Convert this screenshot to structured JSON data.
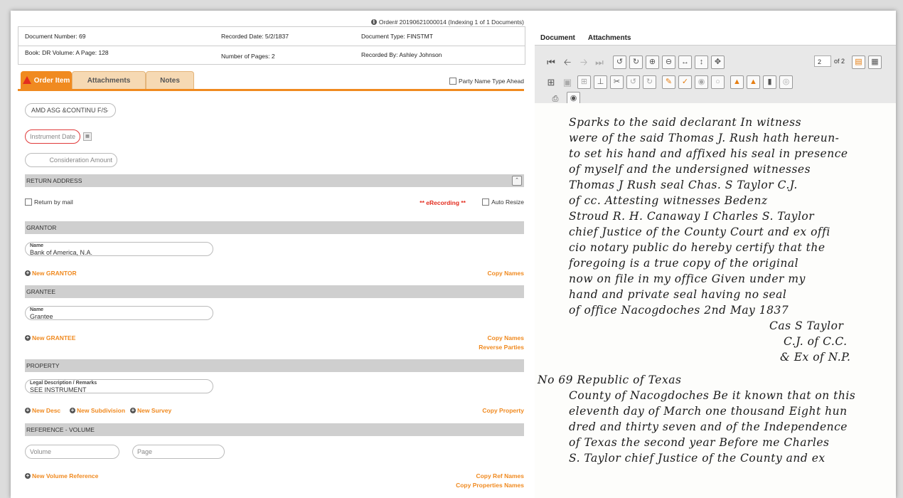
{
  "order": {
    "text": "Order# 20190621000014 (Indexing 1 of 1 Documents)"
  },
  "info": {
    "doc_number": "Document Number: 69",
    "recorded_date": "Recorded Date: 5/2/1837",
    "doc_type": "Document Type: FINSTMT",
    "book_volume_page": "Book: DR   Volume: A   Page: 128",
    "num_pages": "Number of Pages: 2",
    "recorded_by": "Recorded By: Ashley Johnson"
  },
  "tabs": [
    "Order Item",
    "Attachments",
    "Notes"
  ],
  "party_type_ahead": "Party Name Type Ahead",
  "form": {
    "instrument_type": "AMD ASG &CONTINU F/S",
    "instrument_date_placeholder": "Instrument Date",
    "consideration_placeholder": "Consideration Amount",
    "return_address": "RETURN ADDRESS",
    "return_by_mail": "Return by mail",
    "erecording": "** eRecording **",
    "auto_resize": "Auto Resize",
    "grantor_header": "GRANTOR",
    "grantor_name_label": "Name",
    "grantor_name": "Bank of America, N.A.",
    "new_grantor": "New GRANTOR",
    "copy_names_1": "Copy Names",
    "grantee_header": "GRANTEE",
    "grantee_name_label": "Name",
    "grantee_name": "Grantee",
    "new_grantee": "New GRANTEE",
    "copy_names_2": "Copy Names",
    "reverse_parties": "Reverse Parties",
    "property_header": "PROPERTY",
    "legal_desc_label": "Legal Description / Remarks",
    "legal_desc": "SEE INSTRUMENT",
    "new_desc": "New Desc",
    "new_subdivision": "New Subdivision",
    "new_survey": "New Survey",
    "copy_property": "Copy Property",
    "reference_header": "REFERENCE - VOLUME",
    "volume_placeholder": "Volume",
    "page_placeholder": "Page",
    "new_volume_ref": "New Volume Reference",
    "copy_ref_names": "Copy Ref Names",
    "copy_props_names": "Copy Properties Names"
  },
  "viewer": {
    "tabs": [
      "Document",
      "Attachments"
    ],
    "page_current": "2",
    "page_total": "of 2",
    "handwriting": [
      "Sparks to the said declarant  In witness",
      "were of the said Thomas J. Rush hath hereun-",
      "to set his hand and affixed his seal in presence",
      "of myself and the undersigned witnesses",
      "Thomas J Rush seal  Chas. S Taylor C.J.",
      "of cc. Attesting witnesses  Bedenz",
      "Stroud  R. H. Canaway  I Charles S. Taylor",
      "chief Justice of the County Court and ex offi",
      "cio notary public do hereby certify that the",
      "foregoing is a true copy of the original",
      "now on file in my office  Given under my",
      "hand and private seal having no seal",
      "of office  Nacogdoches 2nd May   1837",
      "Cas S Taylor",
      "C.J. of C.C.",
      "& Ex of N.P.",
      "No 69  Republic of Texas",
      "County of Nacogdoches  Be it known that on this",
      "eleventh day of March one thousand Eight hun",
      "dred and thirty seven and of the Independence",
      "of Texas the second year Before me  Charles",
      "S. Taylor chief Justice of the County and ex"
    ]
  },
  "colors": {
    "accent": "#f08a20",
    "error": "#e32d1f"
  }
}
